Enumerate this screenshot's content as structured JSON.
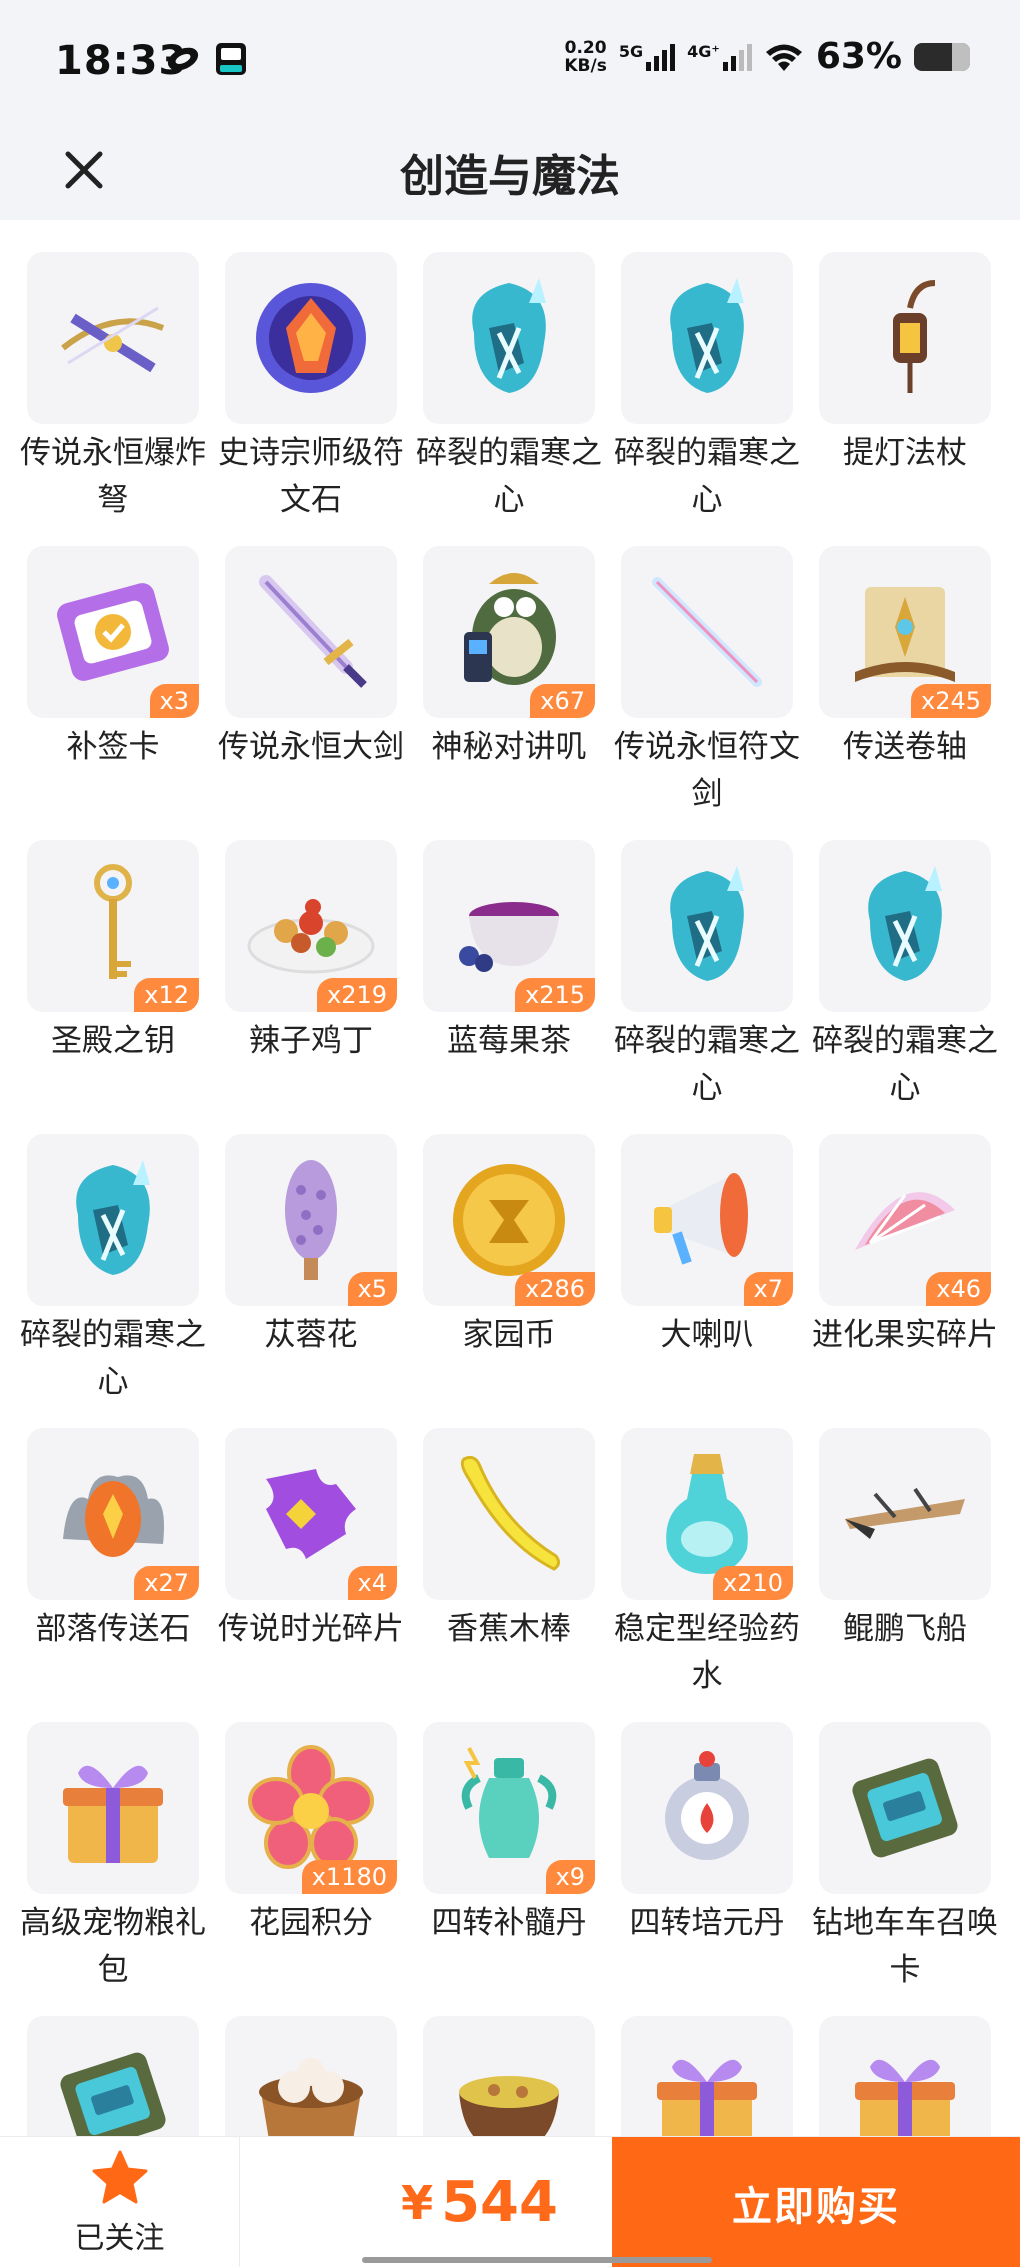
{
  "status_bar": {
    "time": "18:33",
    "net_speed_top": "0.20",
    "net_speed_bottom": "KB/s",
    "net_5g": "5G",
    "net_4g": "4G⁺",
    "battery": "63%"
  },
  "header": {
    "title": "创造与魔法"
  },
  "items": [
    {
      "name": "传说永恒爆炸弩",
      "qty": "",
      "icon": "crossbow"
    },
    {
      "name": "史诗宗师级符文石",
      "qty": "",
      "icon": "rune-stone"
    },
    {
      "name": "碎裂的霜寒之心",
      "qty": "",
      "icon": "frost-heart"
    },
    {
      "name": "碎裂的霜寒之心",
      "qty": "",
      "icon": "frost-heart"
    },
    {
      "name": "提灯法杖",
      "qty": "",
      "icon": "lantern-staff"
    },
    {
      "name": "补签卡",
      "qty": "x3",
      "icon": "sign-card"
    },
    {
      "name": "传说永恒大剑",
      "qty": "",
      "icon": "greatsword"
    },
    {
      "name": "神秘对讲叽",
      "qty": "x67",
      "icon": "walkie-bird"
    },
    {
      "name": "传说永恒符文剑",
      "qty": "",
      "icon": "rune-sword"
    },
    {
      "name": "传送卷轴",
      "qty": "x245",
      "icon": "scroll"
    },
    {
      "name": "圣殿之钥",
      "qty": "x12",
      "icon": "key"
    },
    {
      "name": "辣子鸡丁",
      "qty": "x219",
      "icon": "food-plate"
    },
    {
      "name": "蓝莓果茶",
      "qty": "x215",
      "icon": "tea"
    },
    {
      "name": "碎裂的霜寒之心",
      "qty": "",
      "icon": "frost-heart"
    },
    {
      "name": "碎裂的霜寒之心",
      "qty": "",
      "icon": "frost-heart"
    },
    {
      "name": "碎裂的霜寒之心",
      "qty": "",
      "icon": "frost-heart"
    },
    {
      "name": "苁蓉花",
      "qty": "x5",
      "icon": "flower"
    },
    {
      "name": "家园币",
      "qty": "x286",
      "icon": "coin"
    },
    {
      "name": "大喇叭",
      "qty": "x7",
      "icon": "megaphone"
    },
    {
      "name": "进化果实碎片",
      "qty": "x46",
      "icon": "fruit-slice"
    },
    {
      "name": "部落传送石",
      "qty": "x27",
      "icon": "teleport-stone"
    },
    {
      "name": "传说时光碎片",
      "qty": "x4",
      "icon": "puzzle"
    },
    {
      "name": "香蕉木棒",
      "qty": "",
      "icon": "banana"
    },
    {
      "name": "稳定型经验药水",
      "qty": "x210",
      "icon": "potion"
    },
    {
      "name": "鲲鹏飞船",
      "qty": "",
      "icon": "airship"
    },
    {
      "name": "高级宠物粮礼包",
      "qty": "",
      "icon": "gift"
    },
    {
      "name": "花园积分",
      "qty": "x1180",
      "icon": "garden-flower"
    },
    {
      "name": "四转补髓丹",
      "qty": "x9",
      "icon": "pill-jar"
    },
    {
      "name": "四转培元丹",
      "qty": "",
      "icon": "pill-flask"
    },
    {
      "name": "钻地车车召唤卡",
      "qty": "",
      "icon": "summon-card"
    },
    {
      "name": "",
      "qty": "",
      "icon": "summon-card"
    },
    {
      "name": "",
      "qty": "",
      "icon": "dumplings"
    },
    {
      "name": "",
      "qty": "",
      "icon": "soup"
    },
    {
      "name": "",
      "qty": "",
      "icon": "gift"
    },
    {
      "name": "",
      "qty": "",
      "icon": "gift"
    }
  ],
  "bottom_bar": {
    "follow_label": "已关注",
    "currency": "¥",
    "price": "544",
    "buy_label": "立即购买"
  },
  "colors": {
    "accent": "#ff6814",
    "qty_badge": "#ff8a3d",
    "price": "#ff6a1a",
    "star": "#ff6814"
  }
}
